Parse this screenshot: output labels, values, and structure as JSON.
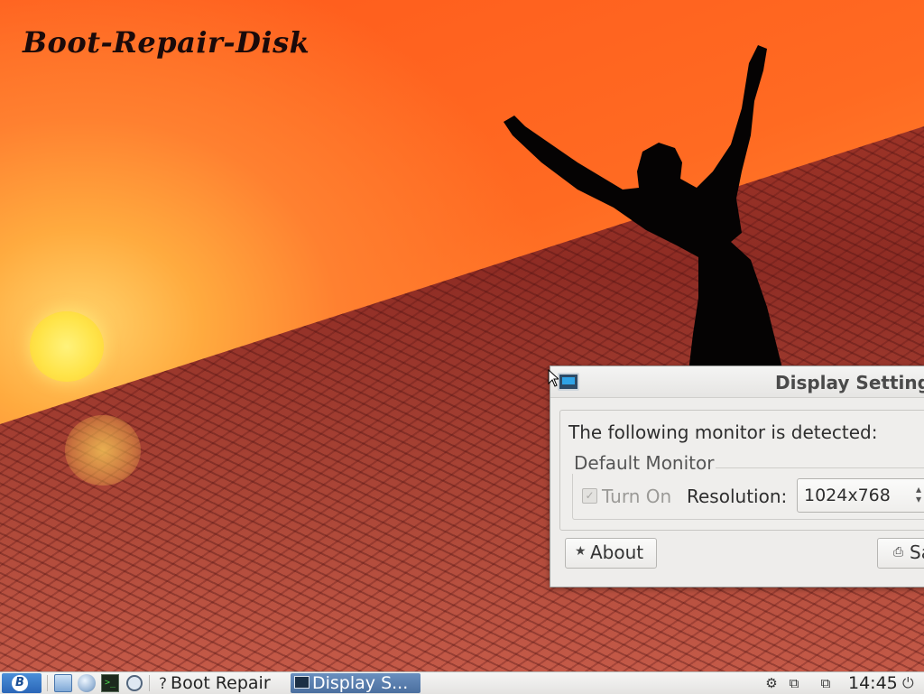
{
  "desktop": {
    "brand_text": "Boot-Repair-Disk"
  },
  "dialog": {
    "title": "Display Settings",
    "detected_text": "The following monitor is detected:",
    "monitor_frame_label": "Default Monitor",
    "turn_on_label": "Turn On",
    "turn_on_checked": true,
    "turn_on_enabled": false,
    "resolution_label": "Resolution:",
    "resolution_value": "1024x768",
    "about_icon": "star-icon",
    "about_label": "About",
    "save_icon": "save-icon",
    "save_label": "Save"
  },
  "taskbar": {
    "start_icon": "boot-repair-disk-logo-icon",
    "quick_launch": [
      {
        "name": "file-manager-icon"
      },
      {
        "name": "web-browser-icon"
      },
      {
        "name": "terminal-icon"
      },
      {
        "name": "search-icon"
      }
    ],
    "tasks": [
      {
        "label": "Boot Repair",
        "icon": "help-icon",
        "active": false
      },
      {
        "label": "Display S...",
        "icon": "monitor-icon",
        "active": true
      }
    ],
    "tray_icons": [
      "network-wired-icon",
      "network-icon",
      "network-icon"
    ],
    "clock": "14:45",
    "power_icon": "power-icon"
  },
  "colors": {
    "sky": "#ff6a22",
    "sun": "#ffe44a",
    "taskbar_active": "#4b6f9f",
    "dialog_bg": "#eeedeb"
  }
}
